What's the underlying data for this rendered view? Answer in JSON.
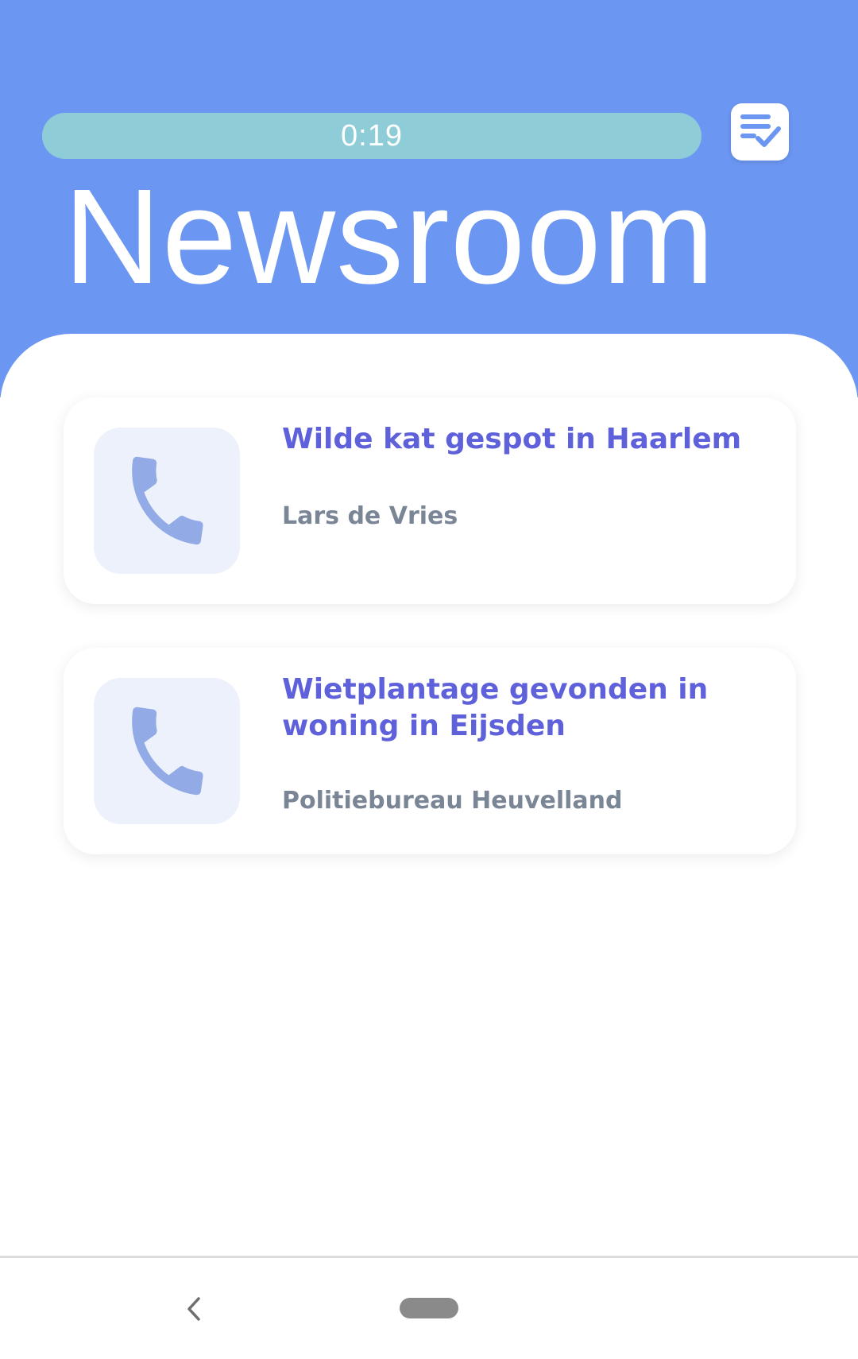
{
  "header": {
    "timer": "0:19",
    "title": "Newsroom",
    "tasks_icon": "tasks-checklist-icon",
    "background_color": "#6b96f2",
    "timer_color": "#8ecdd8"
  },
  "news_items": [
    {
      "icon": "phone-icon",
      "title": "Wilde kat gespot in Haarlem",
      "source": "Lars de Vries"
    },
    {
      "icon": "phone-icon",
      "title": "Wietplantage gevonden in woning in Eijsden",
      "source": "Politiebureau Heuvelland"
    }
  ],
  "colors": {
    "accent_title": "#5f61db",
    "subtitle": "#7a8596",
    "icon_tile": "#edf1fb",
    "icon": "#92aae6"
  },
  "nav": {
    "back_icon": "chevron-left-icon",
    "home_icon": "home-pill-icon"
  }
}
